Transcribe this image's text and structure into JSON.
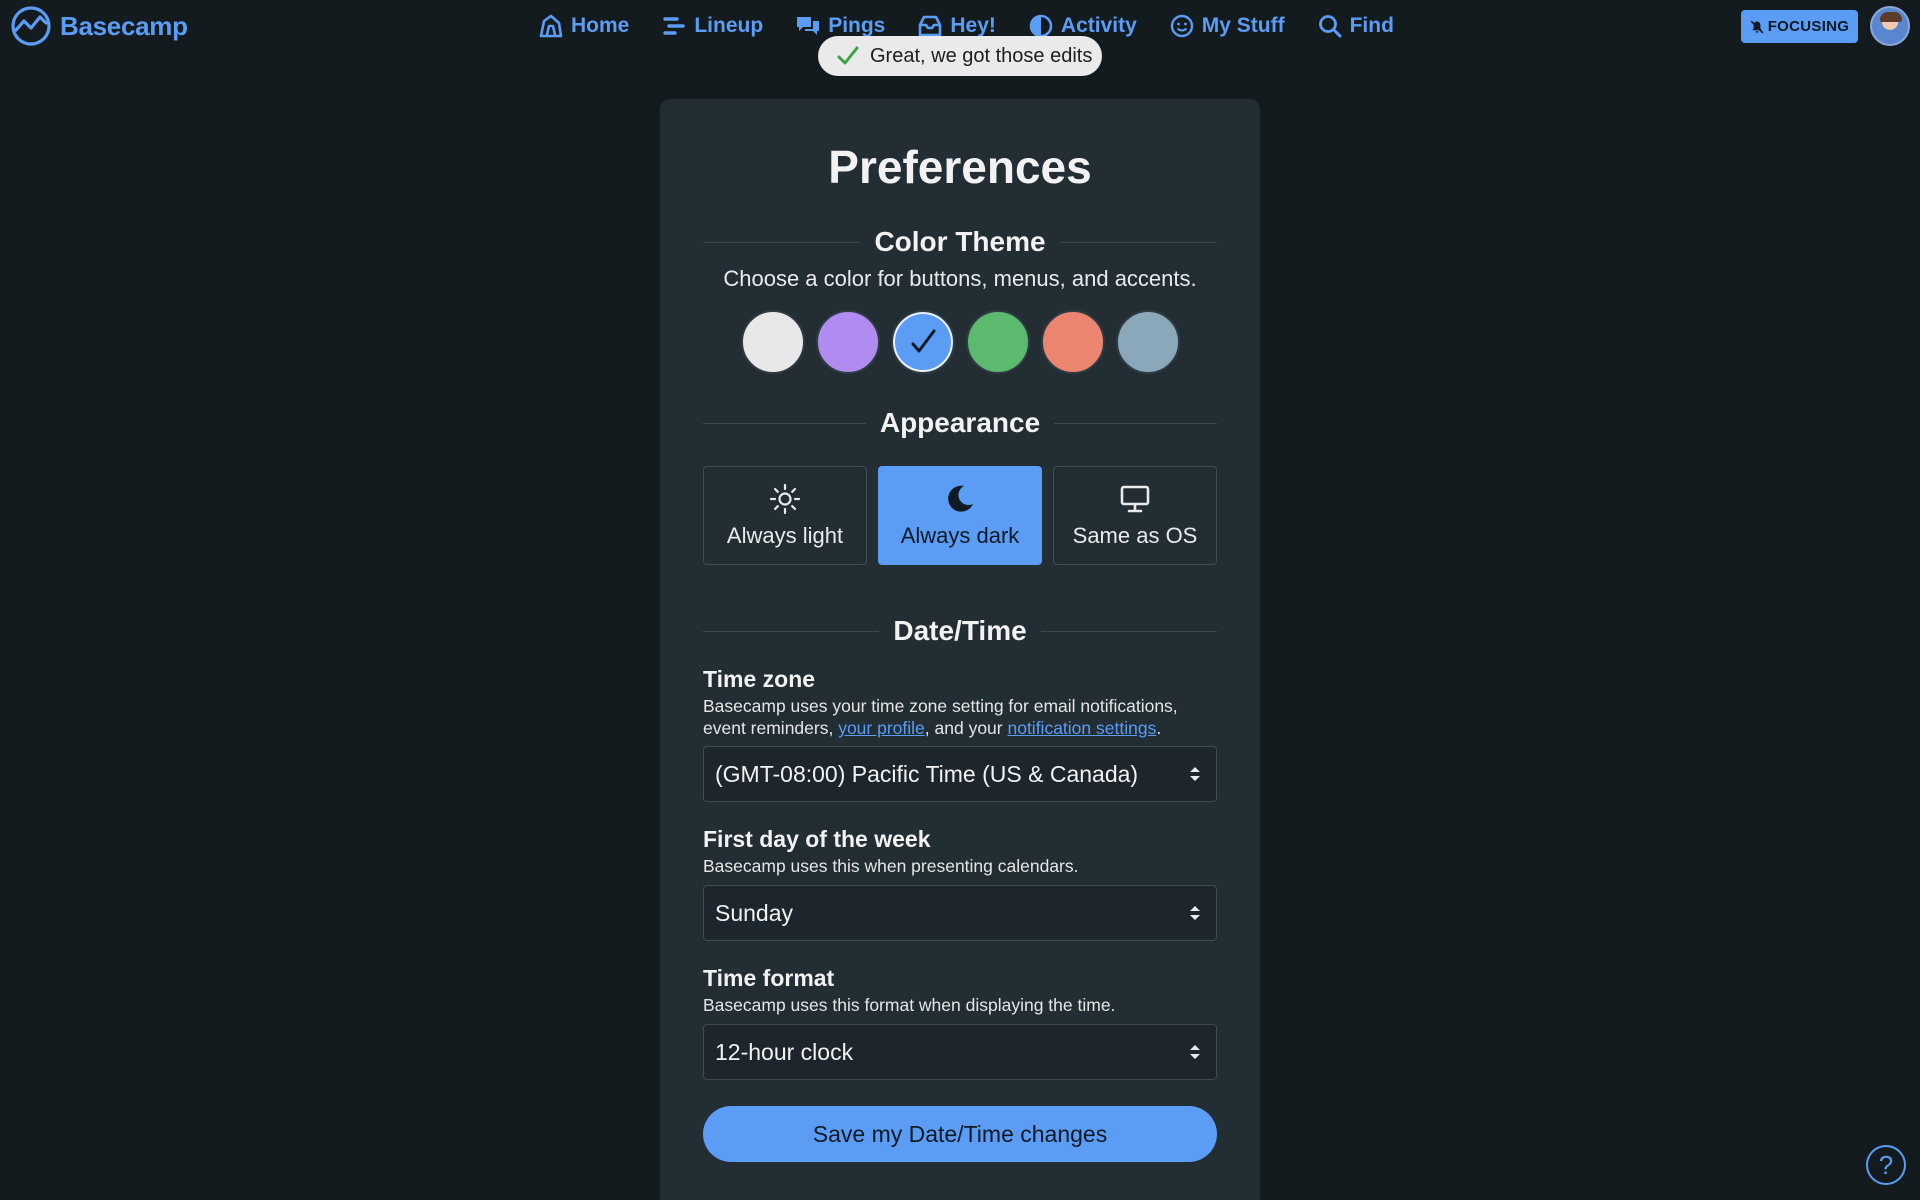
{
  "header": {
    "logo_text": "Basecamp",
    "nav": [
      {
        "label": "Home",
        "icon": "home-icon"
      },
      {
        "label": "Lineup",
        "icon": "lineup-icon"
      },
      {
        "label": "Pings",
        "icon": "pings-icon"
      },
      {
        "label": "Hey!",
        "icon": "hey-inbox-icon"
      },
      {
        "label": "Activity",
        "icon": "activity-icon"
      },
      {
        "label": "My Stuff",
        "icon": "smiley-icon"
      },
      {
        "label": "Find",
        "icon": "search-icon"
      }
    ],
    "focusing_label": "FOCUSING",
    "accent_color": "#5b9cf5"
  },
  "toast": {
    "message": "Great, we got those edits"
  },
  "page": {
    "title": "Preferences"
  },
  "color_theme": {
    "heading": "Color Theme",
    "subtitle": "Choose a color for buttons, menus, and accents.",
    "swatches": [
      {
        "color": "#e8e8e8",
        "selected": false
      },
      {
        "color": "#b18cf0",
        "selected": false
      },
      {
        "color": "#5b9cf5",
        "selected": true
      },
      {
        "color": "#5cba6e",
        "selected": false
      },
      {
        "color": "#ec8570",
        "selected": false
      },
      {
        "color": "#8ba7ba",
        "selected": false
      }
    ]
  },
  "appearance": {
    "heading": "Appearance",
    "options": [
      {
        "label": "Always light",
        "icon": "sun-icon",
        "active": false
      },
      {
        "label": "Always dark",
        "icon": "moon-icon",
        "active": true
      },
      {
        "label": "Same as OS",
        "icon": "monitor-icon",
        "active": false
      }
    ]
  },
  "datetime": {
    "heading": "Date/Time",
    "timezone": {
      "label": "Time zone",
      "help_prefix": "Basecamp uses your time zone setting for email notifications, event reminders, ",
      "help_link1": "your profile",
      "help_mid": ", and your ",
      "help_link2": "notification settings",
      "help_suffix": ".",
      "value": "(GMT-08:00) Pacific Time (US & Canada)"
    },
    "first_day": {
      "label": "First day of the week",
      "help": "Basecamp uses this when presenting calendars.",
      "value": "Sunday"
    },
    "time_format": {
      "label": "Time format",
      "help": "Basecamp uses this format when displaying the time.",
      "value": "12-hour clock"
    },
    "save_label": "Save my Date/Time changes"
  },
  "help_fab": {
    "label": "?"
  }
}
